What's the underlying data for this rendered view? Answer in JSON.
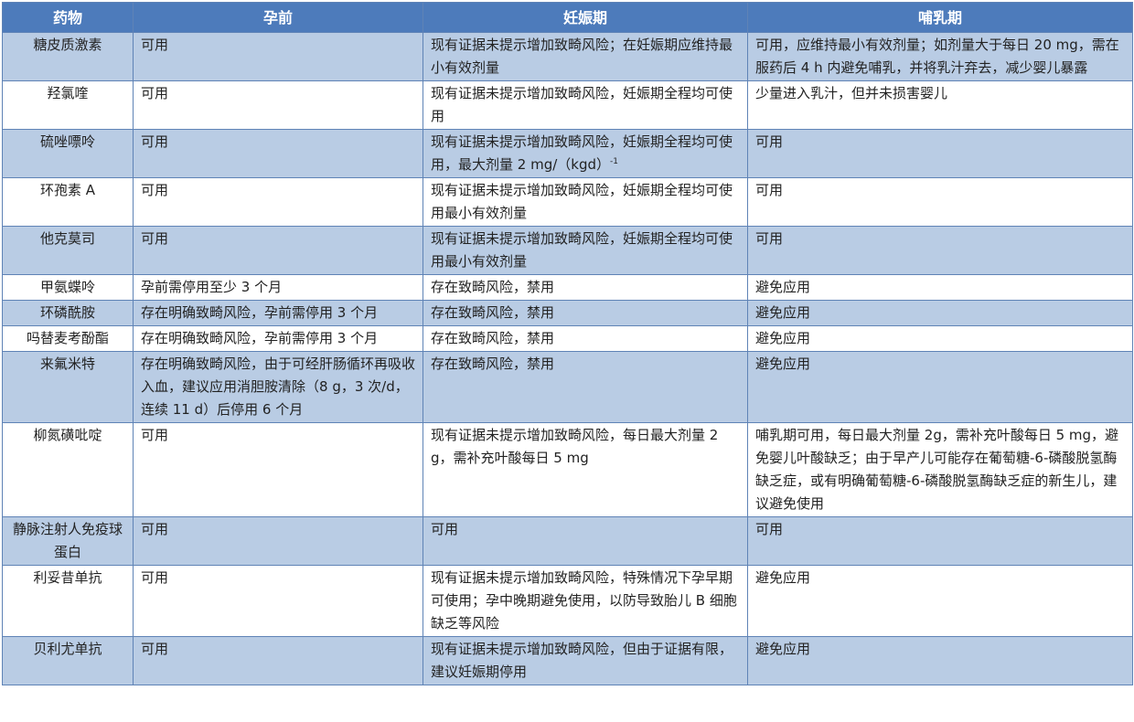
{
  "table": {
    "headers": [
      "药物",
      "孕前",
      "妊娠期",
      "哺乳期"
    ],
    "rows": [
      {
        "drug": "糖皮质激素",
        "pre": "可用",
        "preg": "现有证据未提示增加致畸风险；在妊娠期应维持最小有效剂量",
        "lact": "可用，应维持最小有效剂量；如剂量大于每日 20 mg，需在服药后 4 h 内避免哺乳，并将乳汁弃去，减少婴儿暴露"
      },
      {
        "drug": "羟氯喹",
        "pre": "可用",
        "preg": "现有证据未提示增加致畸风险，妊娠期全程均可使用",
        "lact": "少量进入乳汁，但并未损害婴儿"
      },
      {
        "drug": "硫唑嘌呤",
        "pre": "可用",
        "preg": "现有证据未提示增加致畸风险，妊娠期全程均可使用，最大剂量 2 mg/（kgd）",
        "preg_sup": "-1",
        "lact": "可用"
      },
      {
        "drug": "环孢素 A",
        "pre": "可用",
        "preg": "现有证据未提示增加致畸风险，妊娠期全程均可使用最小有效剂量",
        "lact": "可用"
      },
      {
        "drug": "他克莫司",
        "pre": "可用",
        "preg": "现有证据未提示增加致畸风险，妊娠期全程均可使用最小有效剂量",
        "lact": "可用"
      },
      {
        "drug": "甲氨蝶呤",
        "pre": "孕前需停用至少 3 个月",
        "preg": "存在致畸风险，禁用",
        "lact": "避免应用"
      },
      {
        "drug": "环磷酰胺",
        "pre": "存在明确致畸风险，孕前需停用 3 个月",
        "preg": "存在致畸风险，禁用",
        "lact": "避免应用"
      },
      {
        "drug": "吗替麦考酚酯",
        "pre": "存在明确致畸风险，孕前需停用 3 个月",
        "preg": "存在致畸风险，禁用",
        "lact": "避免应用"
      },
      {
        "drug": "来氟米特",
        "pre": "存在明确致畸风险，由于可经肝肠循环再吸收入血，建议应用消胆胺清除（8 g，3 次/d，连续 11 d）后停用 6 个月",
        "preg": "存在致畸风险，禁用",
        "lact": "避免应用"
      },
      {
        "drug": "柳氮磺吡啶",
        "pre": "可用",
        "preg": "现有证据未提示增加致畸风险，每日最大剂量 2g，需补充叶酸每日 5 mg",
        "lact": "哺乳期可用，每日最大剂量 2g，需补充叶酸每日 5 mg，避免婴儿叶酸缺乏；由于早产儿可能存在葡萄糖-6-磷酸脱氢酶缺乏症，或有明确葡萄糖-6-磷酸脱氢酶缺乏症的新生儿，建议避免使用"
      },
      {
        "drug": "静脉注射人免疫球蛋白",
        "pre": "可用",
        "preg": "可用",
        "lact": "可用"
      },
      {
        "drug": "利妥昔单抗",
        "pre": "可用",
        "preg": "现有证据未提示增加致畸风险，特殊情况下孕早期可使用；孕中晚期避免使用，以防导致胎儿 B 细胞缺乏等风险",
        "lact": "避免应用"
      },
      {
        "drug": "贝利尤单抗",
        "pre": "可用",
        "preg": "现有证据未提示增加致畸风险，但由于证据有限，建议妊娠期停用",
        "lact": "避免应用"
      }
    ]
  },
  "colors": {
    "header_bg": "#4d7bbb",
    "row_shade": "#b9cce4",
    "row_plain": "#ffffff",
    "border": "#5f83b6"
  }
}
